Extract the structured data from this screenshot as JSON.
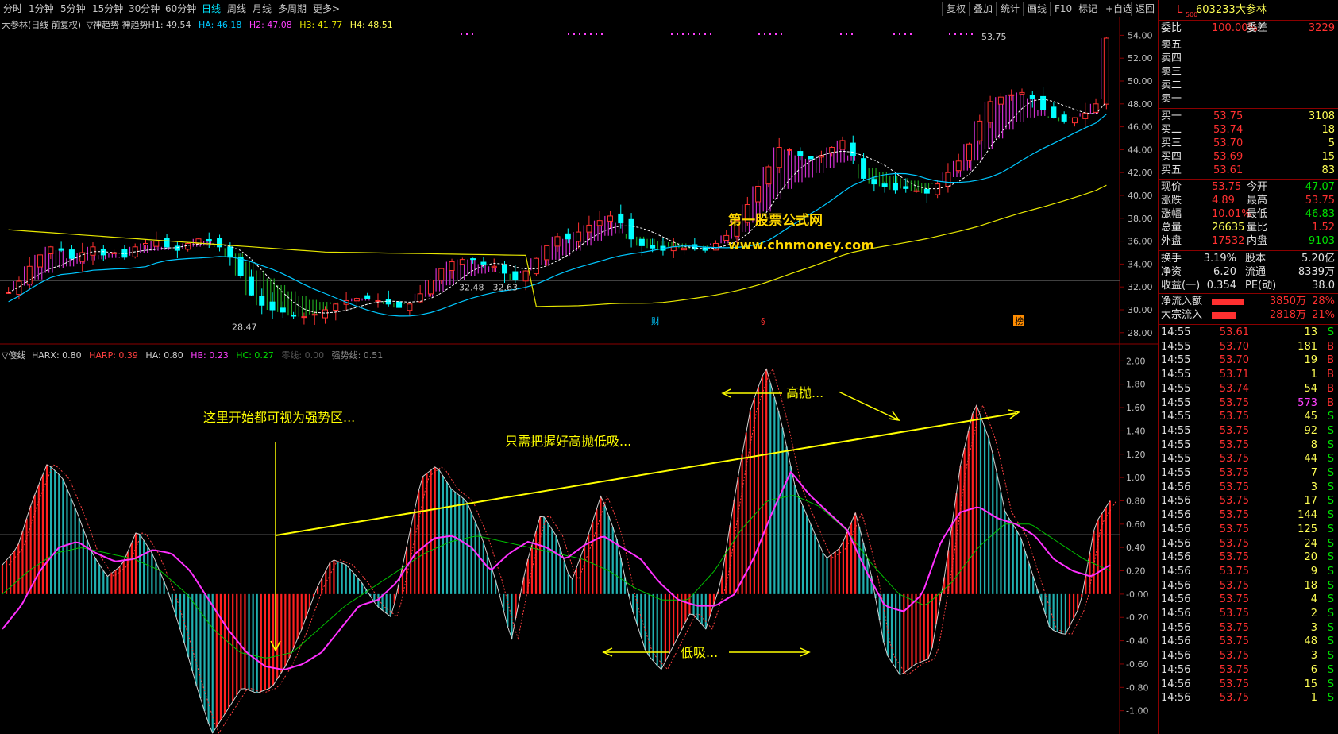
{
  "toolbar": {
    "left": [
      {
        "label": "分时",
        "active": false
      },
      {
        "label": "1分钟",
        "active": false
      },
      {
        "label": "5分钟",
        "active": false
      },
      {
        "label": "15分钟",
        "active": false
      },
      {
        "label": "30分钟",
        "active": false
      },
      {
        "label": "60分钟",
        "active": false
      },
      {
        "label": "日线",
        "active": true
      },
      {
        "label": "周线",
        "active": false
      },
      {
        "label": "月线",
        "active": false
      },
      {
        "label": "多周期",
        "active": false
      },
      {
        "label": "更多>",
        "active": false
      }
    ],
    "right": [
      "复权",
      "叠加",
      "统计",
      "画线",
      "F10",
      "标记",
      "+自选",
      "返回"
    ]
  },
  "upper": {
    "title": "大参林(日线 前复权)",
    "indicator": "▽神趋势 神趋势H1: 49.54",
    "ha": "HA: 46.18",
    "h2": "H2: 47.08",
    "h3": "H3: 41.77",
    "h4": "H4: 48.51",
    "y_ticks": [
      "54.00",
      "52.00",
      "50.00",
      "48.00",
      "46.00",
      "44.00",
      "42.00",
      "40.00",
      "38.00",
      "36.00",
      "34.00",
      "32.00",
      "30.00",
      "28.00"
    ],
    "y_range": [
      27.5,
      55
    ],
    "low_label": "28.47",
    "range_label": "32.48 - 32.63",
    "high_label": "53.75",
    "watermark_1": "第一股票公式网",
    "watermark_2": "www.chnmoney.com",
    "markers": [
      "财",
      "§",
      "榜"
    ]
  },
  "lower": {
    "name": "▽傻线",
    "harx": "HARX: 0.80",
    "harp": "HARP: 0.39",
    "ha": "HA: 0.80",
    "hb": "HB: 0.23",
    "hc": "HC: 0.27",
    "zero": "零线: 0.00",
    "strong": "强势线: 0.51",
    "y_ticks": [
      "2.00",
      "1.80",
      "1.60",
      "1.40",
      "1.20",
      "1.00",
      "0.80",
      "0.60",
      "0.40",
      "0.20",
      "-0.00",
      "-0.20",
      "-0.40",
      "-0.60",
      "-0.80",
      "-1.00"
    ],
    "y_range": [
      -1.2,
      2.05
    ],
    "ann_1": "这里开始都可视为强势区...",
    "ann_2": "只需把握好高抛低吸...",
    "ann_3": "高抛...",
    "ann_4": "低吸..."
  },
  "quote": {
    "code_prefix": "L",
    "code_sub": "500",
    "code": "603233",
    "name": "大参林",
    "weibi_label": "委比",
    "weibi": "100.00%",
    "weicha_label": "委差",
    "weicha": "3229",
    "sells": [
      {
        "label": "卖五"
      },
      {
        "label": "卖四"
      },
      {
        "label": "卖三"
      },
      {
        "label": "卖二"
      },
      {
        "label": "卖一"
      }
    ],
    "buys": [
      {
        "label": "买一",
        "price": "53.75",
        "vol": "3108"
      },
      {
        "label": "买二",
        "price": "53.74",
        "vol": "18"
      },
      {
        "label": "买三",
        "price": "53.70",
        "vol": "5"
      },
      {
        "label": "买四",
        "price": "53.69",
        "vol": "15"
      },
      {
        "label": "买五",
        "price": "53.61",
        "vol": "83"
      }
    ],
    "stats": [
      {
        "l1": "现价",
        "v1": "53.75",
        "c1": "rd",
        "l2": "今开",
        "v2": "47.07",
        "c2": "gr"
      },
      {
        "l1": "涨跌",
        "v1": "4.89",
        "c1": "rd",
        "l2": "最高",
        "v2": "53.75",
        "c2": "rd"
      },
      {
        "l1": "涨幅",
        "v1": "10.01%",
        "c1": "rd",
        "l2": "最低",
        "v2": "46.83",
        "c2": "gr"
      },
      {
        "l1": "总量",
        "v1": "26635",
        "c1": "yl",
        "l2": "量比",
        "v2": "1.52",
        "c2": "rd"
      },
      {
        "l1": "外盘",
        "v1": "17532",
        "c1": "rd",
        "l2": "内盘",
        "v2": "9103",
        "c2": "gr"
      }
    ],
    "stats2": [
      {
        "l1": "换手",
        "v1": "3.19%",
        "l2": "股本",
        "v2": "5.20亿"
      },
      {
        "l1": "净资",
        "v1": "6.20",
        "l2": "流通",
        "v2": "8339万"
      },
      {
        "l1": "收益(一)",
        "v1": "0.354",
        "l2": "PE(动)",
        "v2": "38.0"
      }
    ],
    "flows": [
      {
        "label": "净流入额",
        "value": "3850万",
        "pct": "28%"
      },
      {
        "label": "大宗流入",
        "value": "2818万",
        "pct": "21%"
      }
    ],
    "ticks": [
      {
        "t": "14:55",
        "p": "53.61",
        "v": "13",
        "d": "S"
      },
      {
        "t": "14:55",
        "p": "53.70",
        "v": "181",
        "d": "B"
      },
      {
        "t": "14:55",
        "p": "53.70",
        "v": "19",
        "d": "B"
      },
      {
        "t": "14:55",
        "p": "53.71",
        "v": "1",
        "d": "B"
      },
      {
        "t": "14:55",
        "p": "53.74",
        "v": "54",
        "d": "B"
      },
      {
        "t": "14:55",
        "p": "53.75",
        "v": "573",
        "d": "B"
      },
      {
        "t": "14:55",
        "p": "53.75",
        "v": "45",
        "d": "S"
      },
      {
        "t": "14:55",
        "p": "53.75",
        "v": "92",
        "d": "S"
      },
      {
        "t": "14:55",
        "p": "53.75",
        "v": "8",
        "d": "S"
      },
      {
        "t": "14:55",
        "p": "53.75",
        "v": "44",
        "d": "S"
      },
      {
        "t": "14:55",
        "p": "53.75",
        "v": "7",
        "d": "S"
      },
      {
        "t": "14:56",
        "p": "53.75",
        "v": "3",
        "d": "S"
      },
      {
        "t": "14:56",
        "p": "53.75",
        "v": "17",
        "d": "S"
      },
      {
        "t": "14:56",
        "p": "53.75",
        "v": "144",
        "d": "S"
      },
      {
        "t": "14:56",
        "p": "53.75",
        "v": "125",
        "d": "S"
      },
      {
        "t": "14:56",
        "p": "53.75",
        "v": "24",
        "d": "S"
      },
      {
        "t": "14:56",
        "p": "53.75",
        "v": "20",
        "d": "S"
      },
      {
        "t": "14:56",
        "p": "53.75",
        "v": "9",
        "d": "S"
      },
      {
        "t": "14:56",
        "p": "53.75",
        "v": "18",
        "d": "S"
      },
      {
        "t": "14:56",
        "p": "53.75",
        "v": "4",
        "d": "S"
      },
      {
        "t": "14:56",
        "p": "53.75",
        "v": "2",
        "d": "S"
      },
      {
        "t": "14:56",
        "p": "53.75",
        "v": "3",
        "d": "S"
      },
      {
        "t": "14:56",
        "p": "53.75",
        "v": "48",
        "d": "S"
      },
      {
        "t": "14:56",
        "p": "53.75",
        "v": "3",
        "d": "S"
      },
      {
        "t": "14:56",
        "p": "53.75",
        "v": "6",
        "d": "S"
      },
      {
        "t": "14:56",
        "p": "53.75",
        "v": "15",
        "d": "S"
      },
      {
        "t": "14:56",
        "p": "53.75",
        "v": "1",
        "d": "S"
      }
    ]
  },
  "chart_data": [
    {
      "type": "candlestick",
      "name": "大参林 日线",
      "y_range": [
        27.5,
        55
      ],
      "close_path": [
        31.5,
        32.5,
        33.8,
        34.8,
        35.5,
        35.2,
        34.5,
        35,
        35.5,
        34.8,
        35,
        34.6,
        35.5,
        35.8,
        36,
        35.5,
        35.2,
        35.8,
        36.2,
        36,
        35.5,
        34.6,
        33,
        31.3,
        30.4,
        30,
        29.8,
        29.5,
        29.4,
        29.6,
        30,
        30.5,
        30.8,
        31,
        31,
        30.8,
        30.5,
        30.2,
        30.5,
        31.4,
        32.6,
        33.6,
        34.2,
        34.4,
        34.4,
        34,
        33.8,
        33.2,
        32.6,
        33.4,
        34.5,
        35.6,
        36.4,
        36.2,
        36.8,
        37.4,
        37.8,
        38.2,
        37.6,
        36.2,
        35.6,
        35.4,
        35.2,
        35.5,
        35.4,
        35.3,
        35.2,
        35.8,
        36.5,
        37.8,
        39.2,
        40.8,
        42.5,
        44.2,
        44,
        43.5,
        43.2,
        43.5,
        44.2,
        44.8,
        43.5,
        41.5,
        41,
        40.8,
        40.5,
        40.6,
        40.4,
        40.2,
        41,
        42,
        43,
        44.5,
        46.5,
        48.2,
        48.6,
        48.8,
        49,
        48.5,
        47.5,
        46.8,
        46.5,
        46.8,
        47.2,
        48,
        53.75
      ],
      "h_lines": {
        "ha_end": 46.18,
        "h3_end": 41.77
      }
    },
    {
      "type": "bar+line",
      "name": "傻线",
      "harx_path": [
        0.25,
        0.4,
        0.8,
        1.12,
        1.0,
        0.7,
        0.35,
        0.15,
        0.25,
        0.55,
        0.35,
        0.05,
        -0.35,
        -0.8,
        -1.2,
        -1.0,
        -0.8,
        -0.85,
        -0.8,
        -0.6,
        -0.3,
        0.05,
        0.3,
        0.25,
        0.1,
        -0.1,
        -0.2,
        0.4,
        1.0,
        1.1,
        0.9,
        0.8,
        0.5,
        0.1,
        -0.4,
        0.25,
        0.7,
        0.5,
        0.1,
        0.45,
        0.85,
        0.5,
        -0.1,
        -0.5,
        -0.65,
        -0.4,
        -0.15,
        -0.3,
        0.1,
        0.9,
        1.6,
        1.95,
        1.5,
        0.9,
        0.6,
        0.3,
        0.4,
        0.7,
        0.2,
        -0.5,
        -0.7,
        -0.6,
        -0.55,
        0.2,
        1.1,
        1.65,
        1.3,
        0.7,
        0.5,
        0.1,
        -0.3,
        -0.35,
        -0.1,
        0.6,
        0.8
      ],
      "hb_path": [
        -0.3,
        -0.1,
        0.2,
        0.4,
        0.45,
        0.35,
        0.28,
        0.3,
        0.38,
        0.35,
        0.2,
        -0.05,
        -0.3,
        -0.5,
        -0.62,
        -0.65,
        -0.6,
        -0.5,
        -0.3,
        -0.1,
        -0.05,
        0.1,
        0.35,
        0.48,
        0.5,
        0.4,
        0.2,
        0.35,
        0.45,
        0.4,
        0.3,
        0.42,
        0.5,
        0.4,
        0.3,
        0.1,
        -0.05,
        -0.1,
        -0.1,
        0.0,
        0.3,
        0.7,
        1.05,
        0.85,
        0.7,
        0.55,
        0.2,
        -0.1,
        -0.15,
        0.0,
        0.45,
        0.7,
        0.75,
        0.65,
        0.6,
        0.5,
        0.3,
        0.2,
        0.15,
        0.25
      ],
      "hc_path": [
        0.0,
        0.2,
        0.35,
        0.4,
        0.35,
        0.3,
        0.2,
        0.0,
        -0.3,
        -0.5,
        -0.55,
        -0.5,
        -0.3,
        -0.1,
        0.05,
        0.2,
        0.35,
        0.45,
        0.5,
        0.45,
        0.4,
        0.35,
        0.3,
        0.2,
        0.05,
        -0.05,
        -0.05,
        0.2,
        0.55,
        0.8,
        0.85,
        0.75,
        0.55,
        0.25,
        0.0,
        -0.1,
        0.1,
        0.4,
        0.6,
        0.6,
        0.45,
        0.3,
        0.2
      ],
      "strong_line": 0.51
    }
  ]
}
